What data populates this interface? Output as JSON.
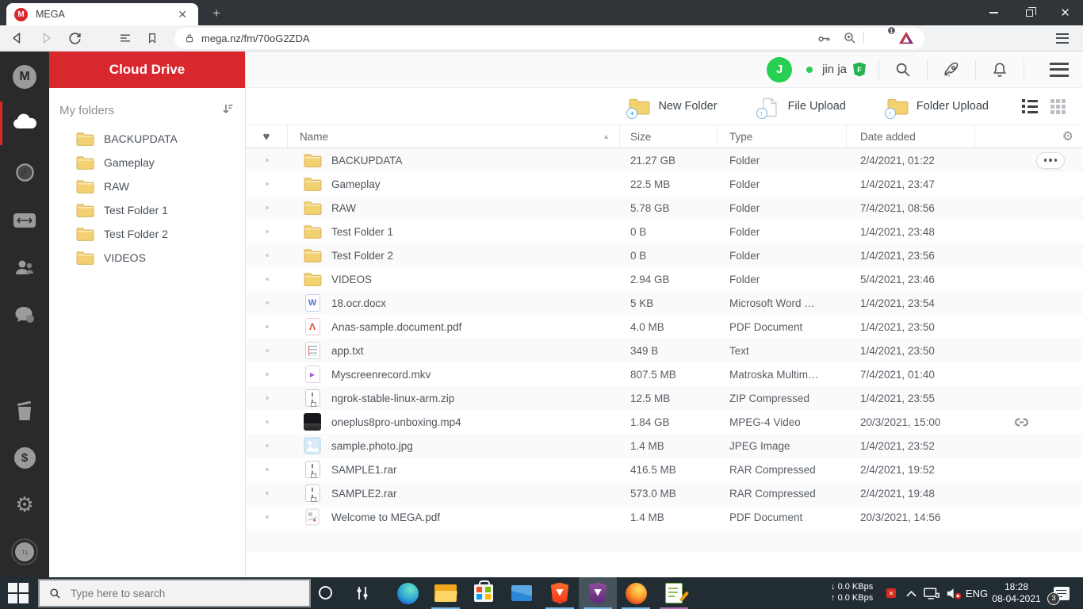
{
  "window": {
    "tab_title": "MEGA"
  },
  "browser": {
    "url": "mega.nz/fm/70oG2ZDA",
    "shield_badge": "1",
    "toolbar_icons": [
      "back",
      "forward",
      "reload",
      "reading-list",
      "bookmark",
      "lock",
      "key",
      "zoom-in",
      "brave-shield",
      "bat-rewards",
      "menu"
    ]
  },
  "mega": {
    "rail": {
      "items": [
        "mega-logo",
        "cloud-drive",
        "recents",
        "transfers",
        "contacts",
        "chat",
        "rubbish-bin",
        "upgrade-account",
        "settings",
        "transfer-widget"
      ],
      "active": "cloud-drive"
    },
    "panel": {
      "title": "Cloud Drive",
      "section": "My folders",
      "folders": [
        "BACKUPDATA",
        "Gameplay",
        "RAW",
        "Test Folder 1",
        "Test Folder 2",
        "VIDEOS"
      ]
    },
    "header": {
      "avatar_letter": "J",
      "username": "jin ja",
      "plan_badge": "F",
      "icons": [
        "search",
        "rocket",
        "bell",
        "menu"
      ]
    },
    "toolbar": {
      "new_folder": "New Folder",
      "file_upload": "File Upload",
      "folder_upload": "Folder Upload",
      "view_icons": [
        "list-view",
        "grid-view"
      ]
    },
    "table": {
      "columns": {
        "name": "Name",
        "size": "Size",
        "type": "Type",
        "date": "Date added"
      },
      "rows": [
        {
          "icon": "folder",
          "name": "BACKUPDATA",
          "size": "21.27 GB",
          "type": "Folder",
          "date": "2/4/2021, 01:22",
          "menu": true
        },
        {
          "icon": "folder",
          "name": "Gameplay",
          "size": "22.5 MB",
          "type": "Folder",
          "date": "1/4/2021, 23:47"
        },
        {
          "icon": "folder",
          "name": "RAW",
          "size": "5.78 GB",
          "type": "Folder",
          "date": "7/4/2021, 08:56"
        },
        {
          "icon": "folder",
          "name": "Test Folder 1",
          "size": "0 B",
          "type": "Folder",
          "date": "1/4/2021, 23:48"
        },
        {
          "icon": "folder",
          "name": "Test Folder 2",
          "size": "0 B",
          "type": "Folder",
          "date": "1/4/2021, 23:56"
        },
        {
          "icon": "folder",
          "name": "VIDEOS",
          "size": "2.94 GB",
          "type": "Folder",
          "date": "5/4/2021, 23:46"
        },
        {
          "icon": "word",
          "name": "18.ocr.docx",
          "size": "5 KB",
          "type": "Microsoft Word …",
          "date": "1/4/2021, 23:54"
        },
        {
          "icon": "pdf",
          "name": "Anas-sample.document.pdf",
          "size": "4.0 MB",
          "type": "PDF Document",
          "date": "1/4/2021, 23:50"
        },
        {
          "icon": "text",
          "name": "app.txt",
          "size": "349 B",
          "type": "Text",
          "date": "1/4/2021, 23:50"
        },
        {
          "icon": "video",
          "name": "Myscreenrecord.mkv",
          "size": "807.5 MB",
          "type": "Matroska Multim…",
          "date": "7/4/2021, 01:40"
        },
        {
          "icon": "zip",
          "name": "ngrok-stable-linux-arm.zip",
          "size": "12.5 MB",
          "type": "ZIP Compressed",
          "date": "1/4/2021, 23:55"
        },
        {
          "icon": "thumb-video",
          "name": "oneplus8pro-unboxing.mp4",
          "size": "1.84 GB",
          "type": "MPEG-4 Video",
          "date": "20/3/2021, 15:00",
          "link": true
        },
        {
          "icon": "image",
          "name": "sample.photo.jpg",
          "size": "1.4 MB",
          "type": "JPEG Image",
          "date": "1/4/2021, 23:52"
        },
        {
          "icon": "zip",
          "name": "SAMPLE1.rar",
          "size": "416.5 MB",
          "type": "RAR Compressed",
          "date": "2/4/2021, 19:52"
        },
        {
          "icon": "zip",
          "name": "SAMPLE2.rar",
          "size": "573.0 MB",
          "type": "RAR Compressed",
          "date": "2/4/2021, 19:48"
        },
        {
          "icon": "pdf-thumb",
          "name": "Welcome to MEGA.pdf",
          "size": "1.4 MB",
          "type": "PDF Document",
          "date": "20/3/2021, 14:56"
        }
      ]
    }
  },
  "taskbar": {
    "search_placeholder": "Type here to search",
    "apps": [
      "cortana",
      "task-view",
      "edge",
      "file-explorer",
      "store",
      "mail",
      "brave",
      "brave-private",
      "firefox",
      "notes"
    ],
    "active_app": "brave-private",
    "tray": {
      "down_speed": "0.0 KBps",
      "up_speed": "0.0 KBps",
      "language": "ENG",
      "time": "18:28",
      "date": "08-04-2021",
      "notification_count": "3"
    }
  },
  "colors": {
    "mega_red": "#d9272e",
    "avatar_green": "#27d052",
    "taskbar_bg": "#212c33",
    "run_indicator_blue": "#76b9ed"
  }
}
